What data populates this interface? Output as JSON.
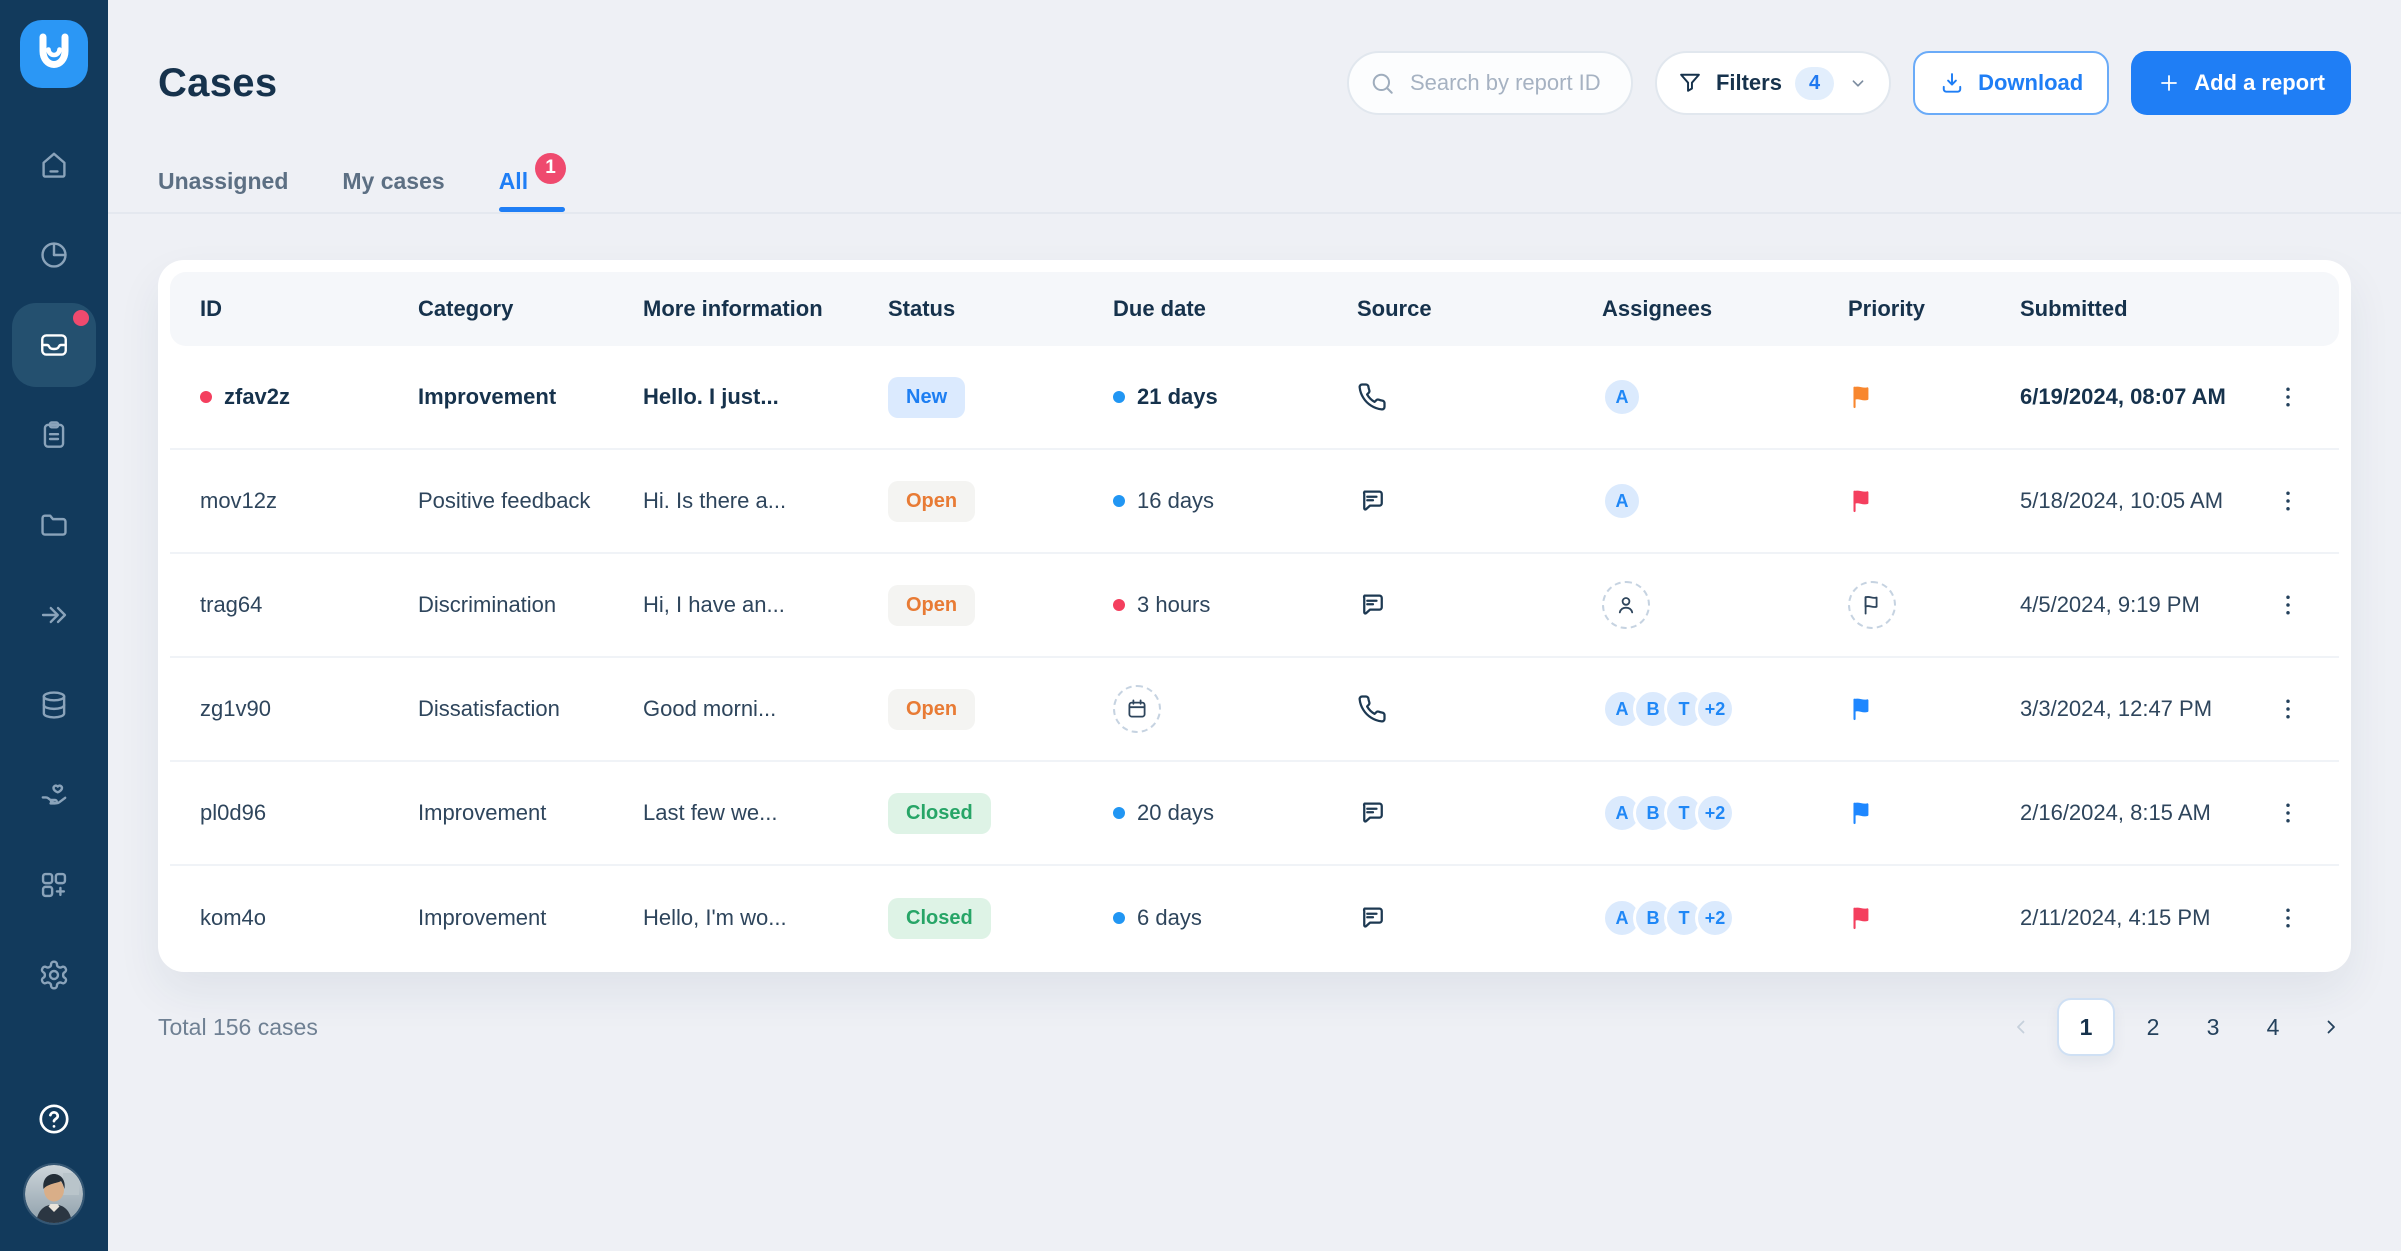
{
  "header": {
    "title": "Cases"
  },
  "search": {
    "placeholder": "Search by report ID"
  },
  "toolbar": {
    "filters_label": "Filters",
    "filters_count": "4",
    "download_label": "Download",
    "add_report_label": "Add a report"
  },
  "tabs": [
    {
      "label": "Unassigned"
    },
    {
      "label": "My cases"
    },
    {
      "label": "All",
      "badge": "1",
      "active": true
    }
  ],
  "sidebar": {
    "logo": "app-logo",
    "items": [
      {
        "name": "home",
        "icon": "home-icon"
      },
      {
        "name": "analytics",
        "icon": "pie-chart-icon"
      },
      {
        "name": "inbox",
        "icon": "inbox-icon",
        "active": true,
        "notification": true
      },
      {
        "name": "reports",
        "icon": "clipboard-icon"
      },
      {
        "name": "files",
        "icon": "folder-icon"
      },
      {
        "name": "collapse",
        "icon": "double-arrow-icon"
      },
      {
        "name": "data",
        "icon": "database-icon"
      },
      {
        "name": "care",
        "icon": "hand-heart-icon"
      },
      {
        "name": "apps",
        "icon": "grid-plus-icon"
      },
      {
        "name": "settings",
        "icon": "gear-icon"
      }
    ]
  },
  "table": {
    "columns": [
      "ID",
      "Category",
      "More information",
      "Status",
      "Due date",
      "Source",
      "Assignees",
      "Priority",
      "Submitted"
    ],
    "rows": [
      {
        "id": "zfav2z",
        "unread": true,
        "category": "Improvement",
        "more_information": "Hello. I just...",
        "status": "New",
        "status_type": "new",
        "due": {
          "dot": "blue",
          "text": "21 days"
        },
        "source": "phone-icon",
        "assignees": {
          "chips": [
            "A"
          ]
        },
        "priority": {
          "flag": "orange"
        },
        "submitted": "6/19/2024, 08:07 AM"
      },
      {
        "id": "mov12z",
        "unread": false,
        "category": "Positive feedback",
        "more_information": "Hi. Is there a...",
        "status": "Open",
        "status_type": "open",
        "due": {
          "dot": "blue",
          "text": "16 days"
        },
        "source": "chat-icon",
        "assignees": {
          "chips": [
            "A"
          ]
        },
        "priority": {
          "flag": "pink"
        },
        "submitted": "5/18/2024, 10:05 AM"
      },
      {
        "id": "trag64",
        "unread": false,
        "category": "Discrimination",
        "more_information": "Hi, I have an...",
        "status": "Open",
        "status_type": "open",
        "due": {
          "dot": "red",
          "text": "3 hours"
        },
        "source": "chat-icon",
        "assignees": {
          "placeholder": "person"
        },
        "priority": {
          "placeholder": "flag"
        },
        "submitted": "4/5/2024, 9:19 PM"
      },
      {
        "id": "zg1v90",
        "unread": false,
        "category": "Dissatisfaction",
        "more_information": "Good morni...",
        "status": "Open",
        "status_type": "open",
        "due": {
          "placeholder": "calendar"
        },
        "source": "phone-icon",
        "assignees": {
          "chips": [
            "A",
            "B",
            "T",
            "+2"
          ]
        },
        "priority": {
          "flag": "blue"
        },
        "submitted": "3/3/2024, 12:47 PM"
      },
      {
        "id": "pl0d96",
        "unread": false,
        "category": "Improvement",
        "more_information": "Last few we...",
        "status": "Closed",
        "status_type": "closed",
        "due": {
          "dot": "blue",
          "text": "20 days"
        },
        "source": "chat-icon",
        "assignees": {
          "chips": [
            "A",
            "B",
            "T",
            "+2"
          ]
        },
        "priority": {
          "flag": "blue"
        },
        "submitted": "2/16/2024, 8:15 AM"
      },
      {
        "id": "kom4o",
        "unread": false,
        "category": "Improvement",
        "more_information": "Hello, I'm wo...",
        "status": "Closed",
        "status_type": "closed",
        "due": {
          "dot": "blue",
          "text": "6 days"
        },
        "source": "chat-icon",
        "assignees": {
          "chips": [
            "A",
            "B",
            "T",
            "+2"
          ]
        },
        "priority": {
          "flag": "pink"
        },
        "submitted": "2/11/2024, 4:15 PM"
      }
    ]
  },
  "footer": {
    "total_label": "Total 156 cases",
    "pagination": {
      "pages": [
        "1",
        "2",
        "3",
        "4"
      ],
      "active": "1"
    }
  },
  "colors": {
    "accent_blue": "#1f7ef5",
    "sidebar_bg": "#123a5c",
    "sidebar_active_bg": "#24506f",
    "sidebar_icon": "#8aa3ba",
    "page_bg": "#eef0f5",
    "text_dark": "#16324c",
    "text_body": "#2e455c",
    "badge_red": "#ef4a6e",
    "flag_orange": "#f8872f",
    "flag_pink": "#f43f5e",
    "flag_blue": "#1e87ff",
    "dot_blue": "#2196f3",
    "dot_red": "#f43f5e",
    "chip_bg": "#dbeafd",
    "chip_text": "#1f87f6",
    "status_new_bg": "#dbeafe",
    "status_new_text": "#1d7ef2",
    "status_open_bg": "#f4f4f2",
    "status_open_text": "#e87b35",
    "status_closed_bg": "#def3e6",
    "status_closed_text": "#27a567"
  }
}
